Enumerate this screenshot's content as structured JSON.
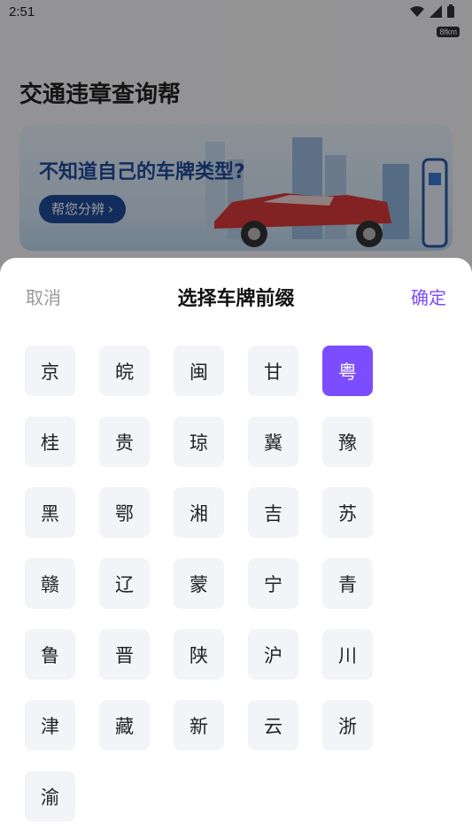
{
  "status_bar": {
    "time": "2:51",
    "net_speed": "8fkm"
  },
  "app": {
    "title": "交通违章查询帮",
    "banner": {
      "text": "不知道自己的车牌类型?",
      "button": "帮您分辨",
      "button_chevron": "›"
    }
  },
  "sheet": {
    "cancel": "取消",
    "title": "选择车牌前缀",
    "confirm": "确定",
    "selected": "粤",
    "keys": [
      "京",
      "皖",
      "闽",
      "甘",
      "粤",
      "桂",
      "贵",
      "琼",
      "冀",
      "豫",
      "黑",
      "鄂",
      "湘",
      "吉",
      "苏",
      "赣",
      "辽",
      "蒙",
      "宁",
      "青",
      "鲁",
      "晋",
      "陕",
      "沪",
      "川",
      "津",
      "藏",
      "新",
      "云",
      "浙",
      "渝"
    ]
  },
  "colors": {
    "accent": "#7b4dff",
    "key_bg": "#f3f4f8",
    "banner_blue": "#1f4c9a"
  }
}
